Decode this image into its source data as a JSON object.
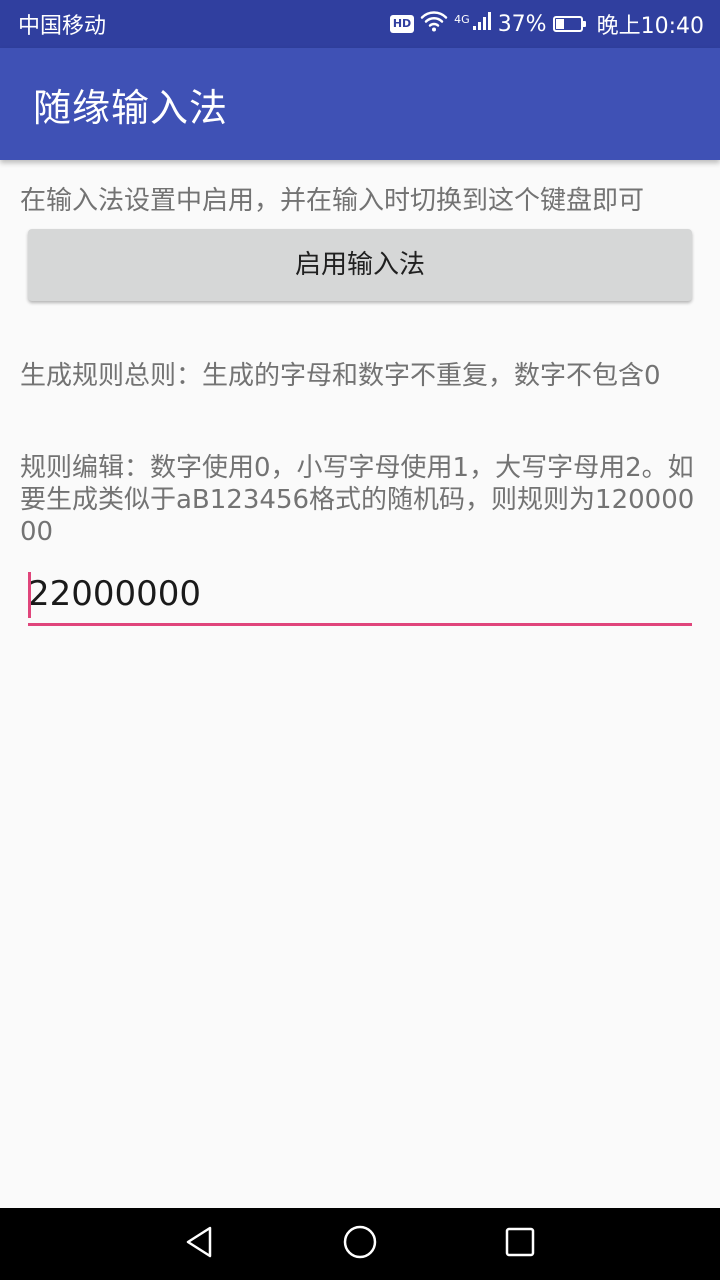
{
  "status_bar": {
    "carrier": "中国移动",
    "hd_badge": "HD",
    "network_type": "4G",
    "battery_percent_text": "37%",
    "battery_level": 0.37,
    "time": "晚上10:40"
  },
  "app_bar": {
    "title": "随缘输入法"
  },
  "main": {
    "enable_hint": "在输入法设置中启用，并在输入时切换到这个键盘即可",
    "enable_button_label": "启用输入法",
    "rule_general": "生成规则总则：生成的字母和数字不重复，数字不包含0",
    "rule_edit": "规则编辑：数字使用0，小写字母使用1，大写字母用2。如要生成类似于aB123456格式的随机码，则规则为12000000",
    "rule_input_value": "22000000"
  },
  "nav_bar": {
    "icons": [
      "back-icon",
      "home-icon",
      "recent-apps-icon"
    ]
  },
  "colors": {
    "status_bar": "#303f9f",
    "primary": "#3f51b5",
    "accent": "#e0457b",
    "background": "#fafafa",
    "button": "#d6d7d7"
  }
}
